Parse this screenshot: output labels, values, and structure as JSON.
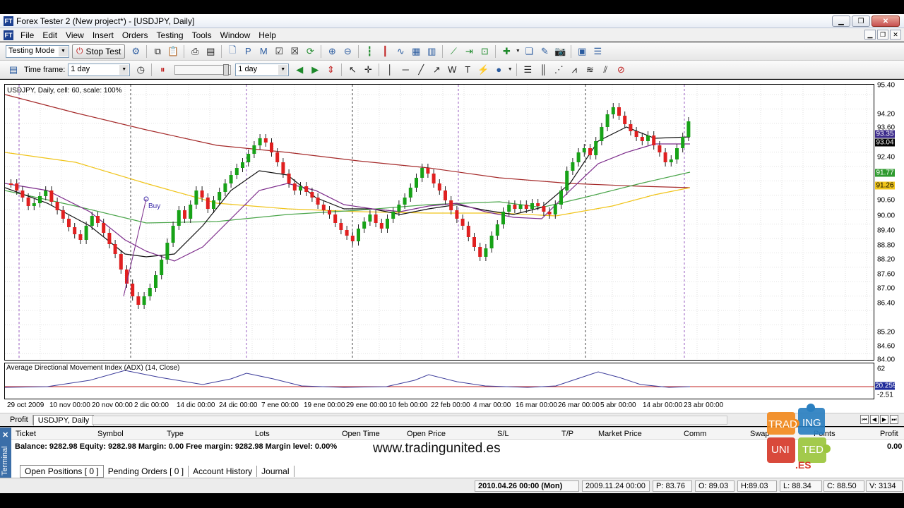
{
  "window": {
    "title": "Forex Tester 2  (New project*) - [USDJPY, Daily]",
    "app_icon": "FT"
  },
  "menu": [
    "File",
    "Edit",
    "View",
    "Insert",
    "Orders",
    "Testing",
    "Tools",
    "Window",
    "Help"
  ],
  "toolbar": {
    "mode_value": "Testing Mode",
    "stop_test_label": "Stop Test",
    "timeframe_label": "Time frame:",
    "timeframe_value": "1 day",
    "step_value": "1 day"
  },
  "chart": {
    "caption": "USDJPY, Daily, cell: 60, scale: 100%",
    "buy_label": "Buy",
    "colors": {
      "bull": "#17a217",
      "bear": "#e02020",
      "ma_red": "#a52a2a",
      "ma_yellow": "#f0c419",
      "ma_green": "#4aa54a",
      "ma_black": "#111111",
      "ma_purple": "#7b2a8a"
    },
    "price_labels": [
      "95.40",
      "94.20",
      "93.60",
      "93.00",
      "92.40",
      "91.80",
      "90.60",
      "90.00",
      "89.40",
      "88.80",
      "88.20",
      "87.60",
      "87.00",
      "86.40",
      "85.20",
      "84.60",
      "84.00"
    ],
    "price_tags": [
      {
        "text": "93.35",
        "bg": "#3b2a8a"
      },
      {
        "text": "93.04",
        "bg": "#000000"
      },
      {
        "text": "91.77",
        "bg": "#2e9a2e"
      },
      {
        "text": "91.26",
        "bg": "#f0c419"
      }
    ],
    "date_labels": [
      "29 oct 2009",
      "10 nov 00:00",
      "20 nov 00:00",
      "2 dic 00:00",
      "14 dic 00:00",
      "24 dic 00:00",
      "7 ene 00:00",
      "19 ene 00:00",
      "29 ene 00:00",
      "10 feb 00:00",
      "22 feb 00:00",
      "4 mar 00:00",
      "16 mar 00:00",
      "26 mar 00:00",
      "5 abr 00:00",
      "14 abr 00:00",
      "23 abr 00:00"
    ]
  },
  "indicator": {
    "caption": "Average Directional Movement Index (ADX) (14, Close)",
    "top_label": "62",
    "value_tag": "20.2598",
    "bottom_label": "-2.51"
  },
  "tabs": {
    "profit": "Profit",
    "symbol": "USDJPY, Daily"
  },
  "terminal": {
    "side_label": "Terminal",
    "columns": [
      "Ticket",
      "Symbol",
      "Type",
      "Lots",
      "Open Time",
      "Open Price",
      "S/L",
      "T/P",
      "Market Price",
      "Comm",
      "Swap",
      "Points",
      "Profit"
    ],
    "balance_line": "Balance: 9282.98 Equity: 9282.98 Margin: 0.00 Free margin: 9282.98 Margin level: 0.00%",
    "profit_value": "0.00",
    "tabs": [
      "Open Positions  [ 0 ]",
      "Pending Orders  [ 0 ]",
      "Account History",
      "Journal"
    ]
  },
  "watermark": "www.tradingunited.es",
  "logo": {
    "t1": "TRAD",
    "t2": "ING",
    "t3": "UNI",
    "t4": "TED",
    "t5": ".ES"
  },
  "status": {
    "datetime": "2010.04.26 00:00 (Mon)",
    "bar_time": "2009.11.24 00:00",
    "p": "P: 83.76",
    "o": "O: 89.03",
    "h": "H:89.03",
    "l": "L: 88.34",
    "c": "C: 88.50",
    "v": "V: 3134"
  }
}
